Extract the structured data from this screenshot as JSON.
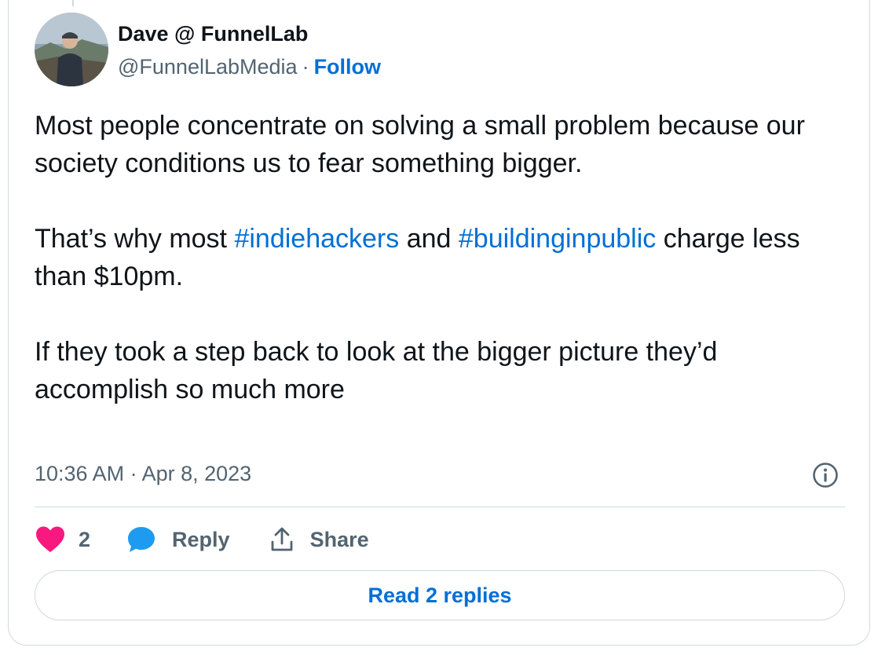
{
  "author": {
    "name": "Dave @ FunnelLab",
    "handle": "@FunnelLabMedia",
    "separator": "·",
    "follow_label": "Follow"
  },
  "tweet": {
    "p1": "Most people concentrate on solving a small problem because our society conditions us to fear something bigger.",
    "p2_before": "That’s why most ",
    "hashtag1": "#indiehackers",
    "p2_middle": " and ",
    "hashtag2": "#buildinginpublic",
    "p2_after": " charge less than $10pm.",
    "p3": "If they took a step back to look at the bigger picture they’d accomplish so much more"
  },
  "timestamp": "10:36 AM · Apr 8, 2023",
  "actions": {
    "like_count": "2",
    "reply_label": "Reply",
    "share_label": "Share"
  },
  "read_replies_label": "Read 2 replies",
  "colors": {
    "link": "#006fd6",
    "like": "#f91880",
    "reply_icon": "#1d9bf0",
    "muted": "#536471",
    "border": "#cfd9de"
  },
  "icons": [
    "heart-icon",
    "reply-bubble-icon",
    "share-icon",
    "info-icon"
  ]
}
